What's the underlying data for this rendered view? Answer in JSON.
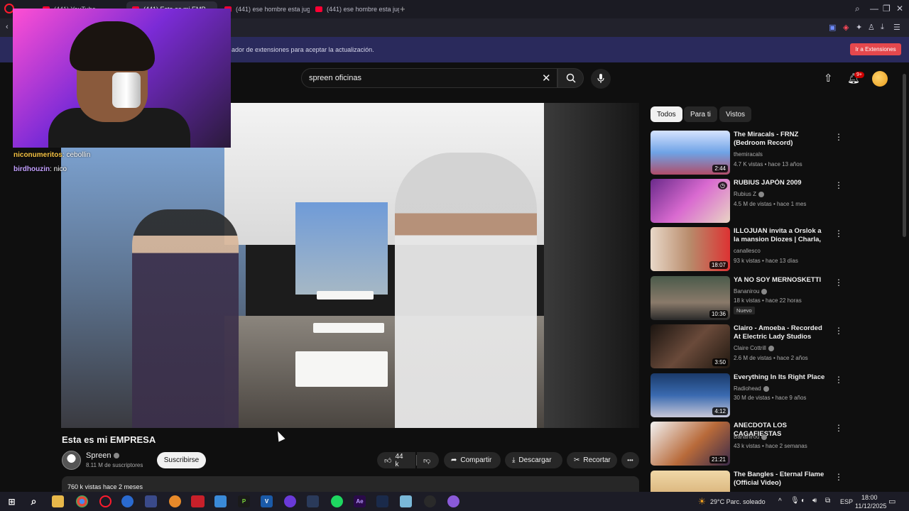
{
  "browser": {
    "tabs": [
      {
        "label": "(441) YouTube",
        "active": false
      },
      {
        "label": "(441) Esta es mi EMP...",
        "active": true
      },
      {
        "label": "(441) ese hombre esta jug",
        "active": false
      },
      {
        "label": "(441) ese hombre esta jug",
        "active": false
      }
    ],
    "new_tab": "+",
    "extension_notice": "ador de extensiones para aceptar la actualización.",
    "extension_button": "Ir a Extensiones"
  },
  "webcam_chat": [
    {
      "user": "niconumeritos",
      "message": "cebollin"
    },
    {
      "user": "birdhouzin",
      "message": "nico"
    }
  ],
  "youtube": {
    "search_query": "spreen oficinas",
    "notification_count": "9+",
    "video": {
      "title": "Esta es mi EMPRESA",
      "channel": "Spreen",
      "subscribers": "8.11 M de suscriptores",
      "subscribe_label": "Suscribirse",
      "likes": "44 k",
      "share_label": "Compartir",
      "download_label": "Descargar",
      "clip_label": "Recortar",
      "more_label": "•••",
      "views_date": "760 k vistas  hace 2 meses"
    },
    "filters": [
      "Todos",
      "Para ti",
      "Vistos"
    ],
    "recommendations": [
      {
        "title": "The Miracals - FRNZ (Bedroom Record)",
        "channel": "themiracals",
        "meta": "4.7 K vistas • hace 13 años",
        "duration": "2:44",
        "verified": false,
        "badge": ""
      },
      {
        "title": "RUBIUS JAPÓN 2009",
        "channel": "Rubius Z",
        "meta": "4.5 M de vistas • hace 1 mes",
        "duration": "",
        "verified": true,
        "badge": ""
      },
      {
        "title": "ILLOJUAN invita a Orslok a la mansion Diozes | Charla, ...",
        "channel": "canallesco",
        "meta": "93 k vistas • hace 13 días",
        "duration": "18:07",
        "verified": false,
        "badge": ""
      },
      {
        "title": "YA NO SOY MERNOSKETTI",
        "channel": "Bananirou",
        "meta": "18 k vistas • hace 22 horas",
        "duration": "10:36",
        "verified": true,
        "badge": "Nuevo"
      },
      {
        "title": "Clairo - Amoeba - Recorded At Electric Lady Studios",
        "channel": "Claire Cottrill",
        "meta": "2.6 M de vistas • hace 2 años",
        "duration": "3:50",
        "verified": true,
        "badge": ""
      },
      {
        "title": "Everything In Its Right Place",
        "channel": "Radiohead",
        "meta": "30 M de vistas • hace 9 años",
        "duration": "4:12",
        "verified": true,
        "badge": ""
      },
      {
        "title": "ANECDOTA LOS CAGAFIESTAS",
        "channel": "Bananirou",
        "meta": "43 k vistas • hace 2 semanas",
        "duration": "21:21",
        "verified": true,
        "badge": ""
      },
      {
        "title": "The Bangles - Eternal Flame (Official Video)",
        "channel": "",
        "meta": "",
        "duration": "",
        "verified": false,
        "badge": ""
      }
    ]
  },
  "taskbar": {
    "weather": "29°C  Parc. soleado",
    "language": "ESP",
    "time": "18:00",
    "date": "11/12/2025"
  }
}
